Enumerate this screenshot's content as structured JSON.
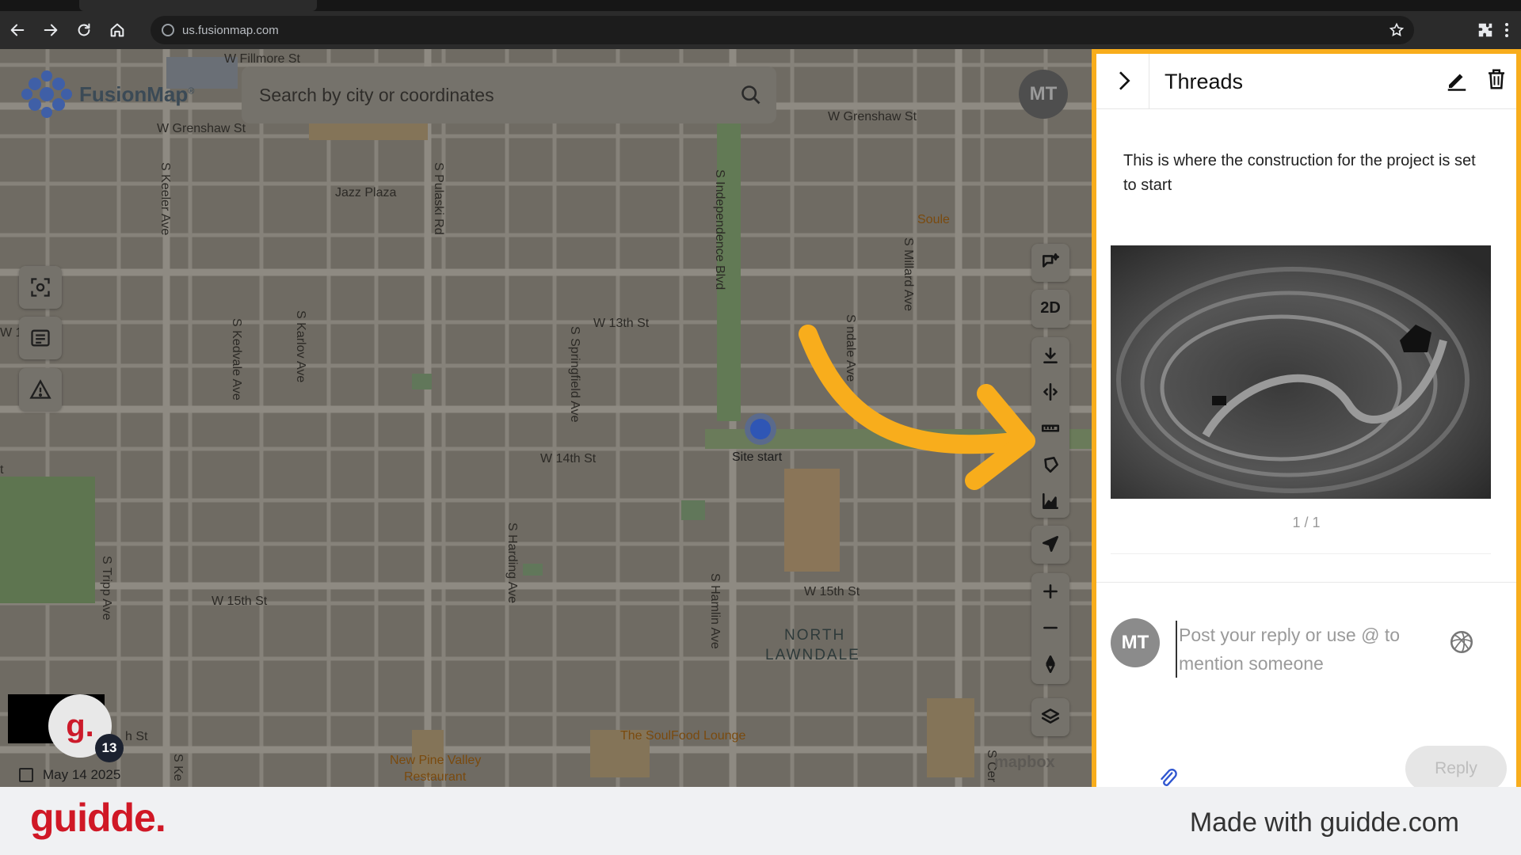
{
  "browser": {
    "url": "us.fusionmap.com"
  },
  "app": {
    "name": "FusionMap",
    "search_placeholder": "Search by city or coordinates",
    "user_initials": "MT",
    "view_mode": "2D",
    "date": "May 14 2025",
    "attribution": "mapbox"
  },
  "map": {
    "labels": {
      "w_fillmore": "W Fillmore St",
      "w_grenshaw_left": "W Grenshaw St",
      "w_grenshaw_right": "W Grenshaw St",
      "jazz_plaza": "Jazz Plaza",
      "s_keeler": "S Keeler Ave",
      "s_pulaski": "S Pulaski Rd",
      "s_independence": "S Independence Blvd",
      "soule": "Soule",
      "s_millard": "S Millard Ave",
      "w_13th": "W 13th St",
      "w_13th_cut": "W 1",
      "s_kedvale": "S Kedvale Ave",
      "s_karlov": "S Karlov Ave",
      "s_springfield": "S Springfield Ave",
      "s_drake_partial": "S     ndale Ave",
      "w_14th": "W 14th St",
      "site_start": "Site start",
      "s_harding": "S Harding Ave",
      "s_hamlin": "S Hamlin Ave",
      "w_15th_left": "W 15th St",
      "w_15th_right": "W 15th St",
      "s_tripp": "S Tripp Ave",
      "north_lawndale_1": "NORTH",
      "north_lawndale_2": "LAWNDALE",
      "soulfood": "The SoulFood Lounge",
      "new_pine_1": "New Pine Valley",
      "new_pine_2": "Restaurant",
      "h_st": "h St",
      "s_ke": "S Ke",
      "s_cer": "S Cer",
      "edge_t": "t"
    }
  },
  "threads_panel": {
    "title": "Threads",
    "message": "This is where the construction for the project is set to start",
    "image_pager": "1 / 1",
    "reply_placeholder": "Post your reply or use @ to mention someone",
    "reply_avatar": "MT",
    "reply_button": "Reply"
  },
  "guidde": {
    "badge_letter": "g.",
    "badge_count": "13",
    "brand": "guidde.",
    "made_with": "Made with guidde.com"
  },
  "colors": {
    "highlight": "#f8ad1c",
    "guidde_red": "#d01826"
  }
}
